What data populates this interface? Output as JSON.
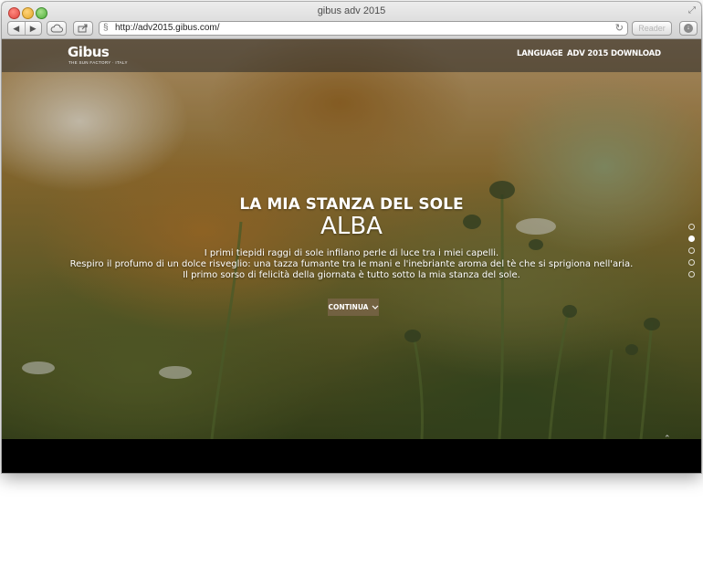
{
  "window": {
    "title": "gibus adv 2015",
    "url": "http://adv2015.gibus.com/",
    "reader_label": "Reader"
  },
  "site": {
    "logo": "Gibus",
    "logo_tagline": "THE SUN FACTORY · ITALY",
    "nav": [
      {
        "label": "LANGUAGE"
      },
      {
        "label": "ADV 2015 DOWNLOAD"
      }
    ]
  },
  "hero": {
    "headline": "LA MIA STANZA DEL SOLE",
    "subheadline": "ALBA",
    "lines": [
      "I primi tiepidi raggi di sole infilano perle di luce tra i miei capelli.",
      "Respiro il profumo di un dolce risveglio: una tazza fumante tra le mani e l'inebriante aroma del tè che si sprigiona nell'aria.",
      "Il primo sorso di felicità della giornata è tutto sotto la mia stanza del sole."
    ],
    "cta_label": "CONTINUA",
    "slides_total": 5,
    "active_slide": 2
  },
  "icons": {
    "back": "chevron-left-icon",
    "forward": "chevron-right-icon",
    "cloud": "cloud-icon",
    "share": "share-icon",
    "reload": "reload-icon",
    "download": "download-icon",
    "cta": "chevron-down-icon",
    "scroll_top": "chevron-up-icon"
  }
}
